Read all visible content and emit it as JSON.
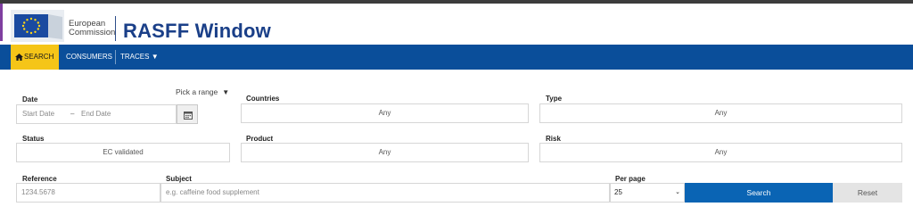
{
  "header": {
    "org_line1": "European",
    "org_line2": "Commission",
    "app_title": "RASFF Window"
  },
  "nav": {
    "search": "SEARCH",
    "consumers": "CONSUMERS",
    "traces": "TRACES"
  },
  "form": {
    "date_label": "Date",
    "range_picker": "Pick a range",
    "date_start_placeholder": "Start Date",
    "date_separator": "–",
    "date_end_placeholder": "End Date",
    "countries_label": "Countries",
    "countries_value": "Any",
    "type_label": "Type",
    "type_value": "Any",
    "status_label": "Status",
    "status_value": "EC validated",
    "product_label": "Product",
    "product_value": "Any",
    "risk_label": "Risk",
    "risk_value": "Any",
    "reference_label": "Reference",
    "reference_placeholder": "1234.5678",
    "subject_label": "Subject",
    "subject_placeholder": "e.g. caffeine food supplement",
    "per_page_label": "Per page",
    "per_page_value": "25",
    "search_button": "Search",
    "reset_button": "Reset"
  },
  "colors": {
    "brand_blue": "#0a4e9a",
    "active_yellow": "#f5c518",
    "search_button": "#0a64b4"
  }
}
